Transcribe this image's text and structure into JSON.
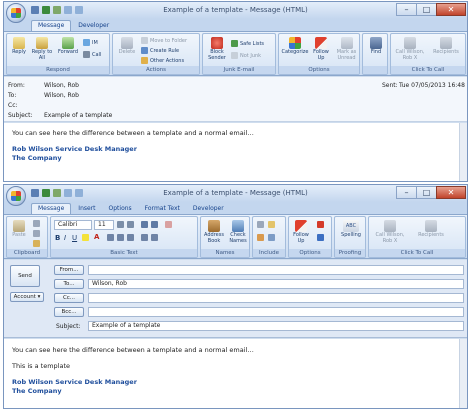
{
  "colors": {
    "accent": "#15428b",
    "signature": "#1f4e9c",
    "titlebar": "#c3d6ee"
  },
  "window1": {
    "title": "Example of a template - Message (HTML)",
    "tabs": [
      "Message",
      "Developer"
    ],
    "groups": {
      "respond": "Respond",
      "actions": "Actions",
      "junk": "Junk E-mail",
      "options": "Options",
      "find": "",
      "clicktocall": "Click To Call"
    },
    "buttons": {
      "reply": "Reply",
      "reply_all": "Reply to All",
      "forward": "Forward",
      "im": "IM",
      "call": "Call",
      "delete": "Delete",
      "move_to_folder": "Move to Folder",
      "create_rule": "Create Rule",
      "other_actions": "Other Actions",
      "block_sender": "Block Sender",
      "safe_lists": "Safe Lists",
      "not_junk": "Not Junk",
      "categorize": "Categorize",
      "follow_up": "Follow Up",
      "mark_as_unread": "Mark as Unread",
      "find": "Find",
      "call_wilson": "Call Wilson, Rob X",
      "recipients": "Recipients"
    },
    "header": {
      "from_label": "From:",
      "from_value": "Wilson, Rob",
      "to_label": "To:",
      "to_value": "Wilson, Rob",
      "cc_label": "Cc:",
      "cc_value": "",
      "subject_label": "Subject:",
      "subject_value": "Example of a template",
      "sent_label": "Sent:",
      "sent_value": "Tue 07/05/2013 16:48"
    },
    "body": {
      "line1": "You can see here the difference between a template and a normal email…",
      "sig_name": "Rob Wilson Service Desk Manager",
      "sig_company": "The Company"
    }
  },
  "window2": {
    "title": "Example of a template - Message (HTML)",
    "tabs": [
      "Message",
      "Insert",
      "Options",
      "Format Text",
      "Developer"
    ],
    "groups": {
      "clipboard": "Clipboard",
      "basic_text": "Basic Text",
      "names": "Names",
      "include": "Include",
      "options": "Options",
      "proofing": "Proofing",
      "clicktocall": "Click To Call"
    },
    "font": {
      "name": "Calibri",
      "size": "11"
    },
    "buttons": {
      "paste": "Paste",
      "address_book": "Address Book",
      "check_names": "Check Names",
      "follow_up": "Follow Up",
      "spelling": "Spelling",
      "call_wilson": "Call Wilson, Rob X",
      "recipients": "Recipients"
    },
    "compose": {
      "send": "Send",
      "account": "Account",
      "from": "From...",
      "to": "To...",
      "cc": "Cc...",
      "bcc": "Bcc...",
      "subject_label": "Subject:",
      "from_value": "",
      "to_value": "Wilson, Rob",
      "cc_value": "",
      "bcc_value": "",
      "subject_value": "Example of a template"
    },
    "body": {
      "line1": "You can see here the difference between a template and a normal email…",
      "line2": "This is a template",
      "sig_name": "Rob Wilson Service Desk Manager",
      "sig_company": "The Company"
    }
  }
}
